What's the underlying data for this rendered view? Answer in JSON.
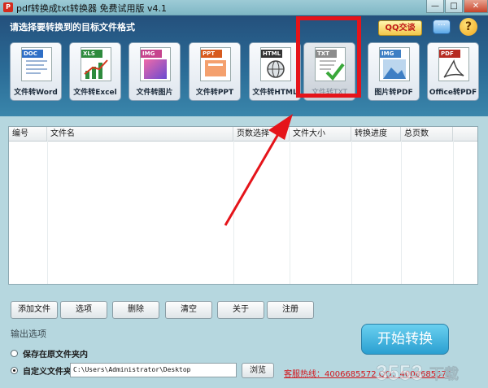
{
  "window": {
    "title": "pdf转换成txt转换器 免费试用版 v4.1",
    "controls": {
      "minimize": "—",
      "maximize": "□",
      "close": "✕"
    }
  },
  "banner": {
    "prompt": "请选择要转换到的目标文件格式",
    "qq_label": "QQ交谈",
    "chat_glyph": "···",
    "help_glyph": "?"
  },
  "formats": [
    {
      "tag": "DOC",
      "label": "文件转Word",
      "tag_color": "#2f6fc6",
      "active": false
    },
    {
      "tag": "XLS",
      "label": "文件转Excel",
      "tag_color": "#2e8b3d",
      "active": false
    },
    {
      "tag": "IMG",
      "label": "文件转图片",
      "tag_color": "#c6448e",
      "active": false
    },
    {
      "tag": "PPT",
      "label": "文件转PPT",
      "tag_color": "#d75a1e",
      "active": false
    },
    {
      "tag": "HTML",
      "label": "文件转HTML",
      "tag_color": "#333333",
      "active": false
    },
    {
      "tag": "TXT",
      "label": "文件转TXT",
      "tag_color": "#8c8c8c",
      "active": true
    },
    {
      "tag": "IMG",
      "label": "图片转PDF",
      "tag_color": "#3f7fc4",
      "active": false
    },
    {
      "tag": "PDF",
      "label": "Office转PDF",
      "tag_color": "#b62b22",
      "active": false
    }
  ],
  "table": {
    "columns": [
      "编号",
      "文件名",
      "页数选择",
      "文件大小",
      "转换进度",
      "总页数"
    ],
    "rows": []
  },
  "buttons": {
    "add": "添加文件",
    "options": "选项",
    "delete": "删除",
    "clear": "清空",
    "about": "关于",
    "register": "注册"
  },
  "output": {
    "section_label": "输出选项",
    "save_original": "保存在原文件夹内",
    "custom_folder": "自定义文件夹",
    "selected": "custom",
    "path": "C:\\Users\\Administrator\\Desktop",
    "browse": "浏览"
  },
  "start_label": "开始转换",
  "hotline": "客服热线：4006685572 QQ：4006685572",
  "watermark": "3553下载",
  "colors": {
    "highlight": "#e5141a",
    "arrow": "#e5141a",
    "banner": "#24507c",
    "start": "#2a9fd1"
  }
}
